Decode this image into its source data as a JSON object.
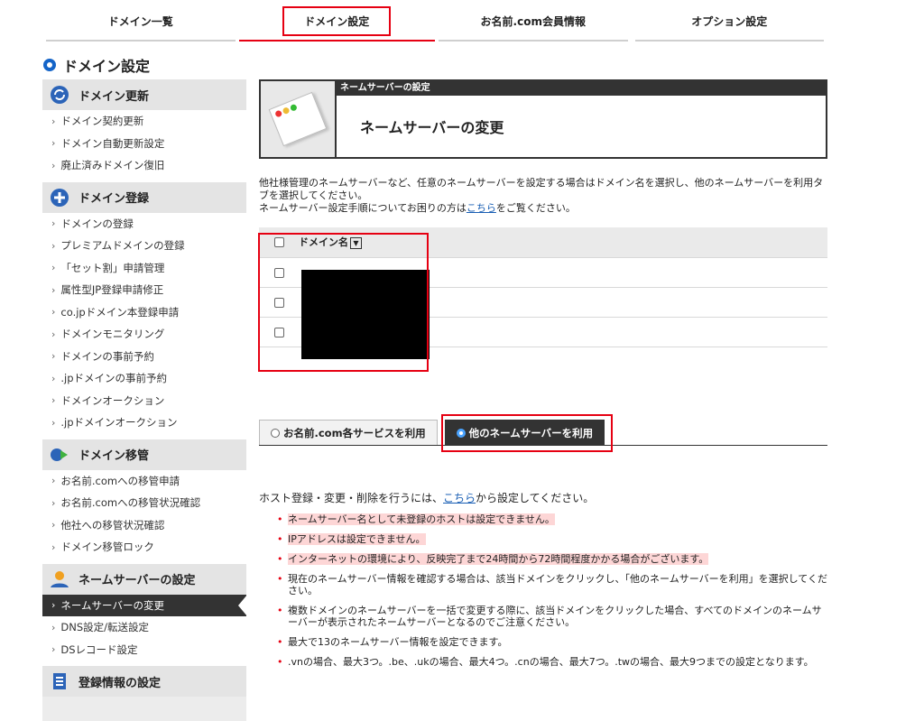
{
  "topnav": {
    "tabs": [
      {
        "label": "ドメイン一覧"
      },
      {
        "label": "ドメイン設定"
      },
      {
        "label": "お名前.com会員情報"
      },
      {
        "label": "オプション設定"
      }
    ]
  },
  "page_title": "ドメイン設定",
  "sidebar": {
    "sections": [
      {
        "title": "ドメイン更新",
        "items": [
          "ドメイン契約更新",
          "ドメイン自動更新設定",
          "廃止済みドメイン復旧"
        ]
      },
      {
        "title": "ドメイン登録",
        "items": [
          "ドメインの登録",
          "プレミアムドメインの登録",
          "「セット割」申請管理",
          "属性型JP登録申請修正",
          "co.jpドメイン本登録申請",
          "ドメインモニタリング",
          "ドメインの事前予約",
          ".jpドメインの事前予約",
          "ドメインオークション",
          ".jpドメインオークション"
        ]
      },
      {
        "title": "ドメイン移管",
        "items": [
          "お名前.comへの移管申請",
          "お名前.comへの移管状況確認",
          "他社への移管状況確認",
          "ドメイン移管ロック"
        ]
      },
      {
        "title": "ネームサーバーの設定",
        "items": [
          "ネームサーバーの変更",
          "DNS設定/転送設定",
          "DSレコード設定"
        ]
      },
      {
        "title": "登録情報の設定",
        "items": []
      }
    ]
  },
  "panel": {
    "caption": "ネームサーバーの設定",
    "title": "ネームサーバーの変更"
  },
  "desc": {
    "line1": "他社様管理のネームサーバーなど、任意のネームサーバーを設定する場合はドメイン名を選択し、他のネームサーバーを利用タブを選択してください。",
    "line2_pre": "ネームサーバー設定手順についてお困りの方は",
    "line2_link": "こちら",
    "line2_post": "をご覧ください。"
  },
  "table": {
    "header": "ドメイン名",
    "sort_icon": "▼"
  },
  "tabs": {
    "tab1": "お名前.com各サービスを利用",
    "tab2": "他のネームサーバーを利用"
  },
  "host": {
    "pre": "ホスト登録・変更・削除を行うには、",
    "link": "こちら",
    "post": "から設定してください。"
  },
  "notes": [
    "ネームサーバー名として未登録のホストは設定できません。",
    "IPアドレスは設定できません。",
    "インターネットの環境により、反映完了まで24時間から72時間程度かかる場合がございます。",
    "現在のネームサーバー情報を確認する場合は、該当ドメインをクリックし、「他のネームサーバーを利用」を選択してください。",
    "複数ドメインのネームサーバーを一括で変更する際に、該当ドメインをクリックした場合、すべてのドメインのネームサーバーが表示されたネームサーバーとなるのでご注意ください。",
    "最大で13のネームサーバー情報を設定できます。",
    ".vnの場合、最大3つ。.be、.ukの場合、最大4つ。.cnの場合、最大7つ。.twの場合、最大9つまでの設定となります。"
  ],
  "colors": {
    "accent_red": "#e60012",
    "dark": "#333333",
    "link_blue": "#1a5fb4"
  }
}
